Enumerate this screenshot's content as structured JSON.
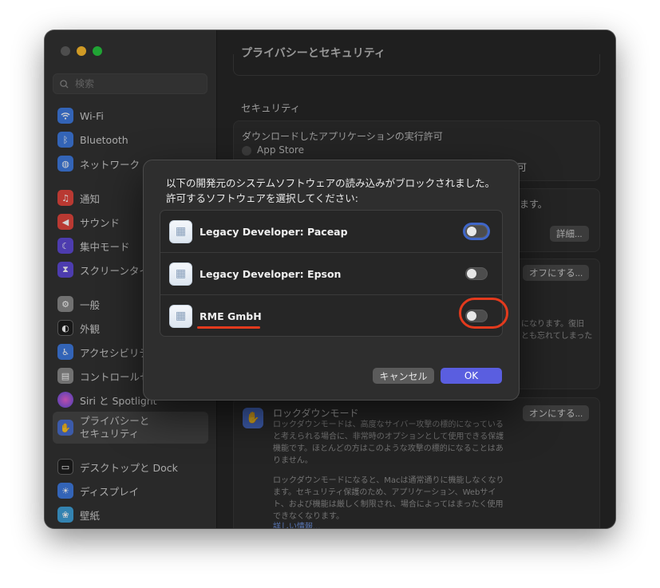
{
  "window": {
    "title": "プライバシーとセキュリティ",
    "traffic_colors": [
      "#5f5f5f",
      "#febc2e",
      "#28c840"
    ]
  },
  "sidebar": {
    "search_placeholder": "検索",
    "items": [
      {
        "label": "Wi-Fi",
        "icon": "wifi-icon",
        "color": "#3f7be0"
      },
      {
        "label": "Bluetooth",
        "icon": "bluetooth-icon",
        "color": "#3f7be0"
      },
      {
        "label": "ネットワーク",
        "icon": "globe-icon",
        "color": "#3f7be0"
      },
      {
        "label": "通知",
        "icon": "bell-icon",
        "color": "#e2463d"
      },
      {
        "label": "サウンド",
        "icon": "speaker-icon",
        "color": "#e2463d"
      },
      {
        "label": "集中モード",
        "icon": "moon-icon",
        "color": "#5e4ad6"
      },
      {
        "label": "スクリーンタイム",
        "icon": "hourglass-icon",
        "color": "#5e4ad6"
      },
      {
        "label": "一般",
        "icon": "gear-icon",
        "color": "#8a8a8a"
      },
      {
        "label": "外観",
        "icon": "appearance-icon",
        "color": "#1e1e1e"
      },
      {
        "label": "アクセシビリティ",
        "icon": "accessibility-icon",
        "color": "#3f7be0"
      },
      {
        "label": "コントロールセンター",
        "icon": "control-center-icon",
        "color": "#8a8a8a"
      },
      {
        "label": "Siri と Spotlight",
        "icon": "siri-icon",
        "color": "#9a4fd8"
      },
      {
        "label": "プライバシーと\nセキュリティ",
        "icon": "hand-icon",
        "color": "#4a6fd0"
      },
      {
        "label": "デスクトップと Dock",
        "icon": "dock-icon",
        "color": "#1e1e1e"
      },
      {
        "label": "ディスプレイ",
        "icon": "sun-icon",
        "color": "#3f7be0"
      },
      {
        "label": "壁紙",
        "icon": "wallpaper-icon",
        "color": "#3fa0d8"
      }
    ]
  },
  "main": {
    "section_label": "セキュリティ",
    "download_label": "ダウンロードしたアプリケーションの実行許可",
    "app_store_label": "App Store",
    "allow_suffix": "可",
    "blocked_suffix": "ます。",
    "details_button": "詳細...",
    "turn_off_button": "オフにする...",
    "filevault_snippet_1": "になります。復旧",
    "filevault_snippet_2": "とも忘れてしまった",
    "lockdown_title": "ロックダウンモード",
    "lockdown_button": "オンにする...",
    "lockdown_desc_1": "ロックダウンモードは、高度なサイバー攻撃の標的になっていると考えられる場合に、非常時のオプションとして使用できる保護機能です。ほとんどの方はこのような攻撃の標的になることはありません。",
    "lockdown_desc_2": "ロックダウンモードになると、Macは通常通りに機能しなくなります。セキュリティ保護のため、アプリケーション、Webサイト、および機能は厳しく制限され、場合によってはまったく使用できなくなります。",
    "learn_more": "詳しい情報..."
  },
  "dialog": {
    "message": "以下の開発元のシステムソフトウェアの読み込みがブロックされました。許可するソフトウェアを選択してください:",
    "rows": [
      {
        "label": "Legacy Developer: Paceap",
        "enabled": false
      },
      {
        "label": "Legacy Developer: Epson",
        "enabled": false
      },
      {
        "label": "RME GmbH",
        "enabled": false
      }
    ],
    "cancel_label": "キャンセル",
    "ok_label": "OK",
    "ok_color": "#5a5ee0",
    "highlight_color": "#e33a1d"
  }
}
